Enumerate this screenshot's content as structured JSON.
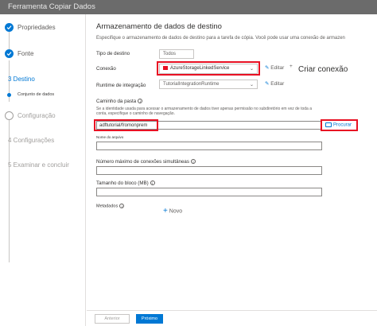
{
  "window": {
    "title": "Ferramenta Copiar Dados"
  },
  "steps": [
    {
      "label": "Propriedades"
    },
    {
      "label": "Fonte"
    },
    {
      "label": "3 Destino"
    },
    {
      "label": "Conjunto de dados"
    },
    {
      "label": "Configuração"
    },
    {
      "label": "4 Configurações"
    },
    {
      "label": "5 Examinar e concluir"
    }
  ],
  "main": {
    "title": "Armazenamento de dados de destino",
    "description": "Especifique o armazenamento de dados de destino para a tarefa de cópia. Você pode usar uma conexão de armazen",
    "target_type": {
      "label": "Tipo de destino",
      "value": "Todos"
    },
    "connection": {
      "label": "Conexão",
      "value": "AzureStorageLinkedService",
      "edit_label": "Editar",
      "add": "+",
      "create_annotation": "Criar conexão"
    },
    "integration_runtime": {
      "label": "Runtime de integração",
      "value": "TutorialIntegrationRuntime",
      "edit_label": "Editar"
    },
    "folder_path": {
      "label": "Caminho da pasta",
      "help_line1": "Se a identidade usada para acessar o armazenamento de dados tiver apenas permissão no subdiretório em vez de toda a",
      "help_line2": "conta, especifique o caminho de navegação.",
      "value": "adftutorial/fromonprem",
      "browse_label": "Procurar"
    },
    "file_name": {
      "label": "Nome do arquivo",
      "value": ""
    },
    "max_connections": {
      "label": "Número máximo de conexões simultâneas",
      "value": ""
    },
    "block_size": {
      "label": "Tamanho do bloco (MB)",
      "value": ""
    },
    "metadata": {
      "label": "Metadados",
      "add_label": "Novo"
    }
  },
  "footer": {
    "previous_label": "Anterior",
    "next_label": "Próximo"
  },
  "colors": {
    "accent": "#0078d4",
    "highlight": "#e81123"
  }
}
